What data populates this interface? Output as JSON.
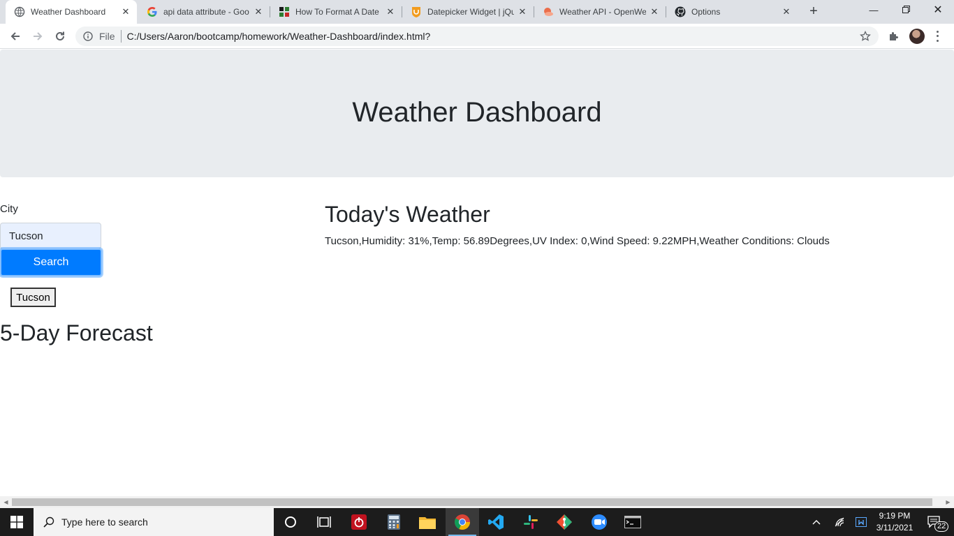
{
  "browser": {
    "tabs": [
      {
        "label": "Weather Dashboard",
        "icon": "globe-icon"
      },
      {
        "label": "api data attribute - Goo",
        "icon": "google-icon"
      },
      {
        "label": "How To Format A Date",
        "icon": "site-icon"
      },
      {
        "label": "Datepicker Widget | jQu",
        "icon": "shield-icon"
      },
      {
        "label": "Weather API - OpenWe",
        "icon": "openweather-icon"
      },
      {
        "label": "Options",
        "icon": "github-icon"
      }
    ],
    "address": {
      "scheme_label": "File",
      "url": "C:/Users/Aaron/bootcamp/homework/Weather-Dashboard/index.html?"
    }
  },
  "page": {
    "title": "Weather Dashboard",
    "city_label": "City",
    "city_value": "Tucson",
    "search_label": "Search",
    "history": [
      "Tucson"
    ],
    "forecast_title": "5-Day Forecast",
    "today_title": "Today's Weather",
    "today_info": "Tucson,Humidity: 31%,Temp: 56.89Degrees,UV Index: 0,Wind Speed: 9.22MPH,Weather Conditions: Clouds"
  },
  "taskbar": {
    "search_placeholder": "Type here to search",
    "time": "9:19 PM",
    "date": "3/11/2021",
    "notification_count": "22"
  },
  "colors": {
    "jumbotron": "#e9ecef",
    "primary_button": "#007bff",
    "input_autofill": "#e8f0fe"
  }
}
